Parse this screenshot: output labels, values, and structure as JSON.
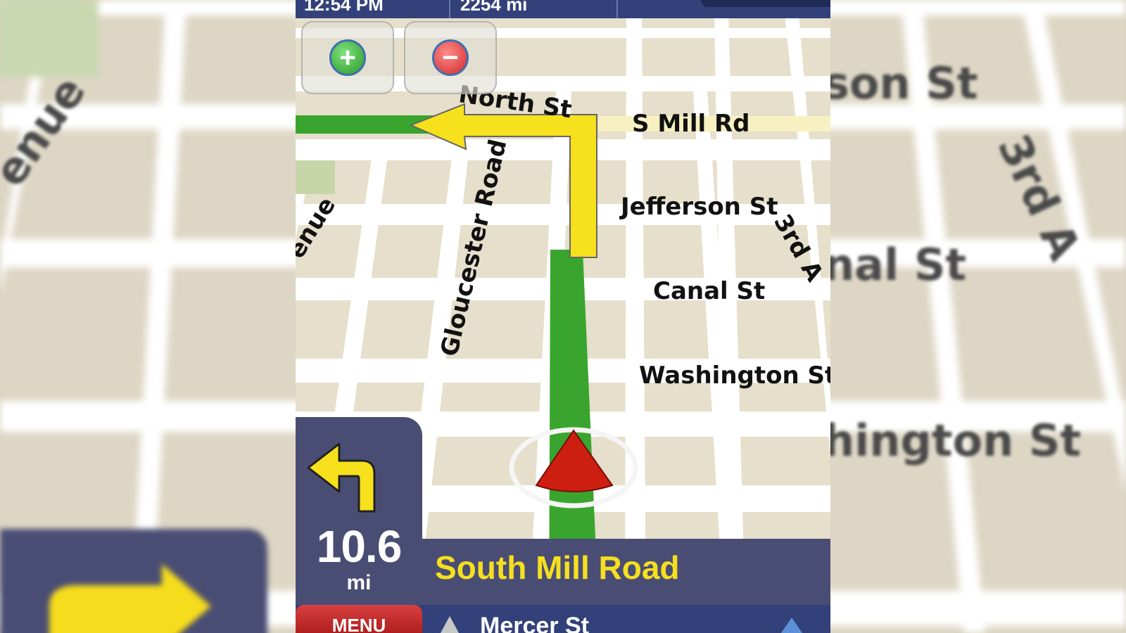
{
  "status": {
    "time": "12:54 PM",
    "distance_remaining": "2254 mi"
  },
  "zoom": {
    "in_label": "+",
    "out_label": "−"
  },
  "streets": {
    "north": "North St",
    "s_mill": "S Mill Rd",
    "jefferson": "Jefferson St",
    "canal": "Canal St",
    "washington": "Washington St",
    "gloucester": "Gloucester Road",
    "avenue": "enue",
    "third": "3rd A"
  },
  "background_labels": {
    "avenue": "enue",
    "jackson": "son St",
    "third": "3rd A",
    "canal": "nal St",
    "washington": "hington St"
  },
  "instruction": {
    "distance": "10.6",
    "unit": "mi",
    "current_street": "South Mill Road"
  },
  "bottom": {
    "menu_label": "MENU",
    "next_street": "Mercer St"
  },
  "colors": {
    "route": "#3aa52e",
    "turn_arrow": "#f7e11c",
    "panel": "#4a4d73",
    "status_bar": "#33417a",
    "position_marker": "#cc1f12"
  }
}
